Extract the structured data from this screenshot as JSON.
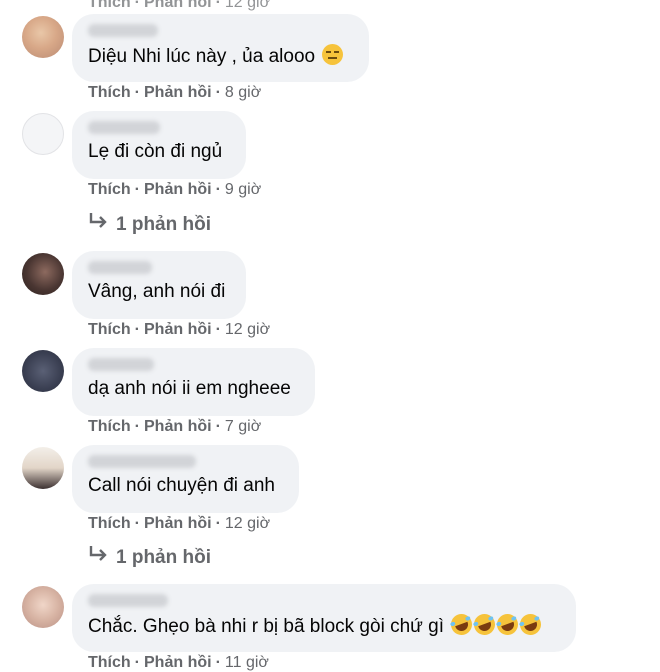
{
  "actions": {
    "like": "Thích",
    "reply": "Phản hồi",
    "separator": "·"
  },
  "top_partial": {
    "time": "12 giờ"
  },
  "comments": [
    {
      "text": "Diệu Nhi lúc này , ủa alooo",
      "emoji": "expressionless-face",
      "time": "8 giờ",
      "replies": null
    },
    {
      "text": "Lẹ đi còn đi ngủ",
      "time": "9 giờ",
      "replies": "1 phản hồi"
    },
    {
      "text": "Vâng, anh nói đi",
      "time": "12 giờ",
      "replies": null
    },
    {
      "text": "dạ anh nói ii em ngheee",
      "time": "7 giờ",
      "replies": null
    },
    {
      "text": "Call nói chuyện đi anh",
      "time": "12 giờ",
      "replies": "1 phản hồi"
    },
    {
      "text": "Chắc. Ghẹo bà nhi r bị bã block gòi chứ gì",
      "emoji": "rolling-on-floor-laughing x4",
      "time": "11 giờ",
      "replies": null
    }
  ],
  "colors": {
    "bubble": "#f0f2f5",
    "secondary_text": "#65676b",
    "primary_text": "#050505"
  }
}
